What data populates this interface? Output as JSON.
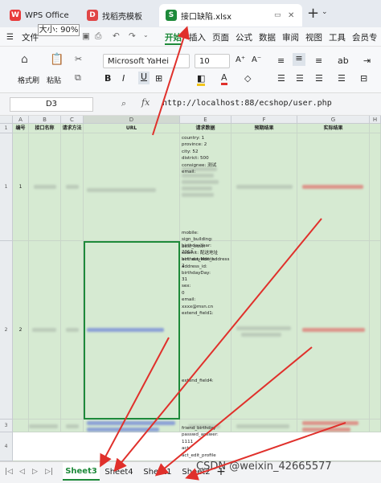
{
  "tabs": [
    {
      "label": "WPS Office",
      "icon": "wps-logo-icon",
      "color": "#e83a3a"
    },
    {
      "label": "找稻壳模板",
      "icon": "docer-icon",
      "color": "#e04646"
    },
    {
      "label": "接口缺陷.xlsx",
      "icon": "S",
      "color": "#1e8a3a"
    }
  ],
  "tooltip": "大小: 90%",
  "menu": {
    "file": "文件",
    "items": [
      "开始",
      "插入",
      "页面",
      "公式",
      "数据",
      "审阅",
      "视图",
      "工具",
      "会员专"
    ]
  },
  "ribbon": {
    "format_painter": "格式刷",
    "paste": "粘贴",
    "font": "Microsoft YaHei",
    "size": "10"
  },
  "formula": {
    "cell_ref": "D3",
    "fx": "fx",
    "value": "http://localhost:88/ecshop/user.php"
  },
  "columns": [
    "A",
    "B",
    "C",
    "D",
    "E",
    "F",
    "G",
    "H"
  ],
  "header_row": [
    "编号",
    "接口名称",
    "请求方法",
    "URL",
    "请求数据",
    "预期结果",
    "实际结果"
  ],
  "rows": [
    {
      "num": "1",
      "id": "1"
    },
    {
      "num": "2",
      "id": "2"
    },
    {
      "num": "3",
      "id": ""
    },
    {
      "num": "4",
      "id": ""
    }
  ],
  "req1": [
    "country: 1",
    "province: 2",
    "city: 52",
    "district: 500",
    "consignee: 测试",
    "email:",
    "",
    "",
    "",
    "",
    "",
    "",
    "",
    "",
    "mobile:",
    "sign_building:",
    "best_time:",
    "submit: 配送地址",
    "act: act_edit_address",
    "address_id:"
  ],
  "req2": [
    "birthdayYear:",
    "2013",
    "birthdayMonth:",
    "2",
    "birthdayDay:",
    "31",
    "sex:",
    "0",
    "email:",
    "xxxx@msn.cn",
    "extend_field1:",
    "",
    "",
    "",
    "",
    "",
    "",
    "",
    "",
    "",
    "extend_field4:",
    "",
    "",
    "",
    "",
    "",
    "",
    "friend_birthday",
    "passwd_answer:",
    "1111",
    "act:",
    "act_edit_profile"
  ],
  "sheets": [
    "Sheet3",
    "Sheet4",
    "Sheet1",
    "Sheet2"
  ],
  "add_sheet": "+",
  "watermark": "CSDN @weixin_42665577",
  "accent": "#1e8a3a",
  "arrow_color": "#e0302b"
}
